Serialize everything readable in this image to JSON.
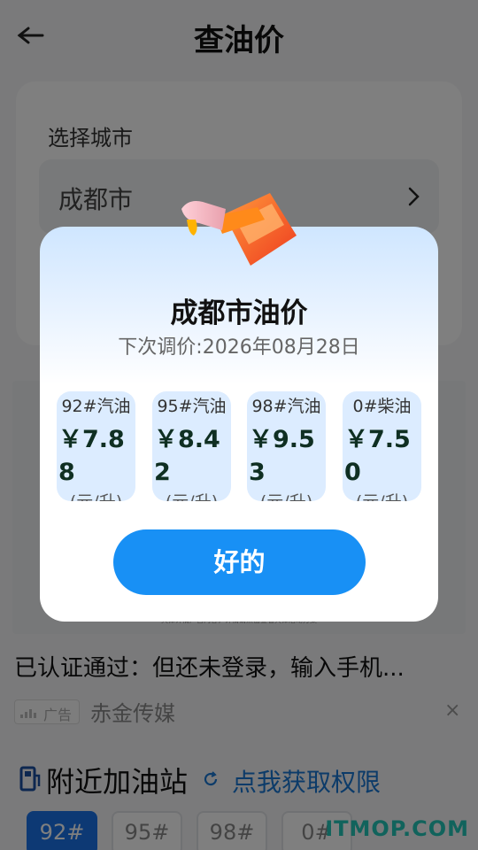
{
  "header": {
    "title": "查油价"
  },
  "city_card": {
    "label": "选择城市",
    "value": "成都市"
  },
  "ad_area": {
    "fine_print": "具体详情广告内容，详情请点击查看具体活动方案"
  },
  "auth": {
    "text": "已认证通过：但还未登录，输入手机..."
  },
  "ad_bar": {
    "badge": "广告",
    "source": "赤金传媒",
    "close": "×"
  },
  "nearby": {
    "title": "附近加油站",
    "link": "点我获取权限"
  },
  "fuel_tabs": [
    {
      "label": "92#",
      "active": true
    },
    {
      "label": "95#",
      "active": false
    },
    {
      "label": "98#",
      "active": false
    },
    {
      "label": "0#",
      "active": false
    }
  ],
  "watermark": "ITMOP.COM",
  "dialog": {
    "title": "成都市油价",
    "subtitle": "下次调价:2026年08月28日",
    "prices": [
      {
        "grade": "92#汽油",
        "price": "￥7.88",
        "unit": "(元/升)"
      },
      {
        "grade": "95#汽油",
        "price": "￥8.42",
        "unit": "(元/升)"
      },
      {
        "grade": "98#汽油",
        "price": "￥9.53",
        "unit": "(元/升)"
      },
      {
        "grade": "0#柴油",
        "price": "￥7.50",
        "unit": "(元/升)"
      }
    ],
    "ok_label": "好的"
  },
  "colors": {
    "accent": "#1890f5",
    "link": "#1976d2",
    "card_bg": "#dcecff"
  },
  "icons": [
    "back-arrow-icon",
    "chevron-right-icon",
    "gas-station-icon",
    "refresh-icon",
    "fuel-nozzle-icon"
  ]
}
